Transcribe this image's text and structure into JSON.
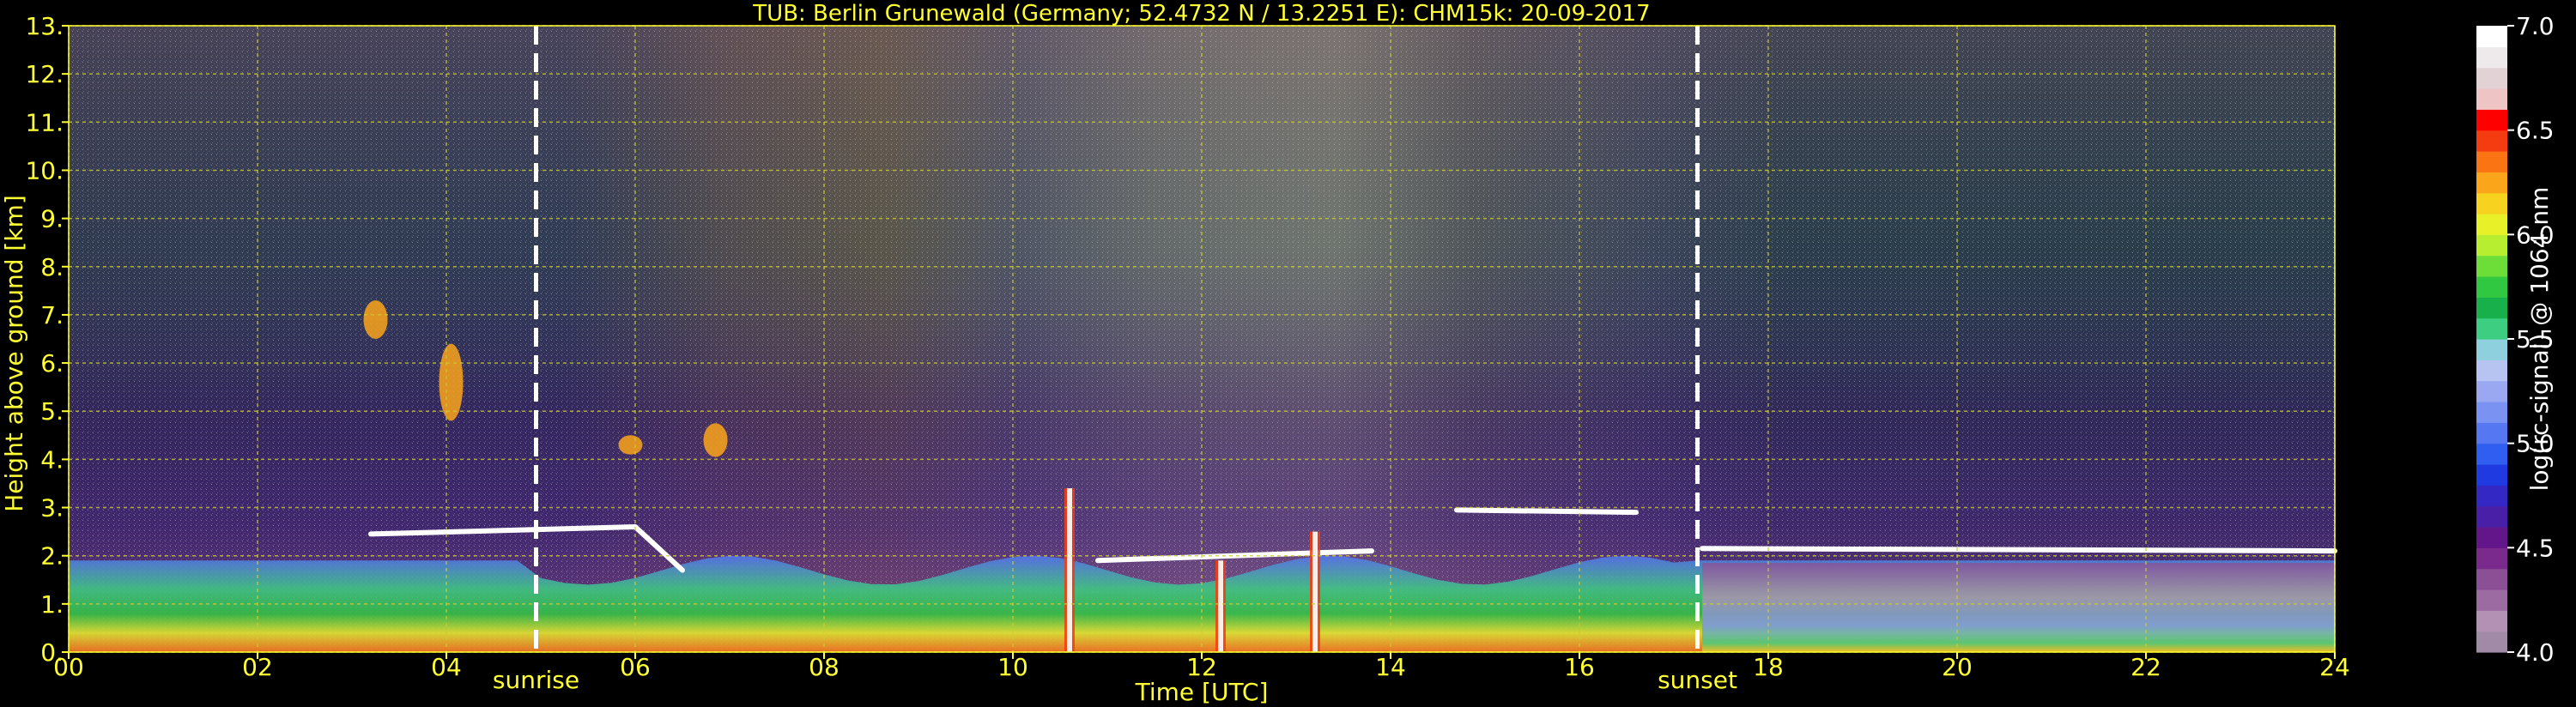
{
  "chart_data": {
    "type": "heatmap",
    "title": "TUB: Berlin Grunewald (Germany; 52.4732 N / 13.2251 E):    CHM15k: 20-09-2017",
    "xlabel": "Time [UTC]",
    "ylabel": "Height above ground [km]",
    "xlim": [
      0,
      24
    ],
    "ylim": [
      0,
      13
    ],
    "x_ticks": [
      {
        "value": 0,
        "label": "00"
      },
      {
        "value": 2,
        "label": "02"
      },
      {
        "value": 4,
        "label": "04"
      },
      {
        "value": 6,
        "label": "06"
      },
      {
        "value": 8,
        "label": "08"
      },
      {
        "value": 10,
        "label": "10"
      },
      {
        "value": 12,
        "label": "12"
      },
      {
        "value": 14,
        "label": "14"
      },
      {
        "value": 16,
        "label": "16"
      },
      {
        "value": 18,
        "label": "18"
      },
      {
        "value": 20,
        "label": "20"
      },
      {
        "value": 22,
        "label": "22"
      },
      {
        "value": 24,
        "label": "24"
      }
    ],
    "y_ticks": [
      {
        "value": 0,
        "label": "0."
      },
      {
        "value": 1,
        "label": "1."
      },
      {
        "value": 2,
        "label": "2."
      },
      {
        "value": 3,
        "label": "3."
      },
      {
        "value": 4,
        "label": "4."
      },
      {
        "value": 5,
        "label": "5."
      },
      {
        "value": 6,
        "label": "6."
      },
      {
        "value": 7,
        "label": "7."
      },
      {
        "value": 8,
        "label": "8."
      },
      {
        "value": 9,
        "label": "9."
      },
      {
        "value": 10,
        "label": "10."
      },
      {
        "value": 11,
        "label": "11."
      },
      {
        "value": 12,
        "label": "12."
      },
      {
        "value": 13,
        "label": "13."
      }
    ],
    "grid": true,
    "markers": [
      {
        "x": 4.95,
        "label": "sunrise"
      },
      {
        "x": 17.25,
        "label": "sunset"
      }
    ],
    "colorbar": {
      "label": "log(rc-signal) @ 1064 nm",
      "range": [
        4.0,
        7.0
      ],
      "ticks": [
        {
          "value": 4.0,
          "label": "4.0"
        },
        {
          "value": 4.5,
          "label": "4.5"
        },
        {
          "value": 5.0,
          "label": "5.0"
        },
        {
          "value": 5.5,
          "label": "5.5"
        },
        {
          "value": 6.0,
          "label": "6.0"
        },
        {
          "value": 6.5,
          "label": "6.5"
        },
        {
          "value": 7.0,
          "label": "7.0"
        }
      ],
      "colors": [
        "#a08aa8",
        "#b391b5",
        "#9b6ba2",
        "#8a4f95",
        "#7a2a8c",
        "#62168a",
        "#4a1fa8",
        "#3328c4",
        "#1e3ae0",
        "#2f5ef0",
        "#5577f2",
        "#7a92f2",
        "#99a8f0",
        "#b7c3f0",
        "#8fd0de",
        "#3ccf82",
        "#18b04a",
        "#2fc840",
        "#6dde38",
        "#b8ee30",
        "#e8f028",
        "#f7d21f",
        "#fba51a",
        "#fb7414",
        "#f53c10",
        "#ff0000",
        "#eec4c4",
        "#e2d2d6",
        "#eeeaec",
        "#ffffff"
      ]
    },
    "colors": {
      "text": "#ffff33",
      "grid": "#cccc33",
      "boundary_layer": "#ffffff"
    }
  }
}
